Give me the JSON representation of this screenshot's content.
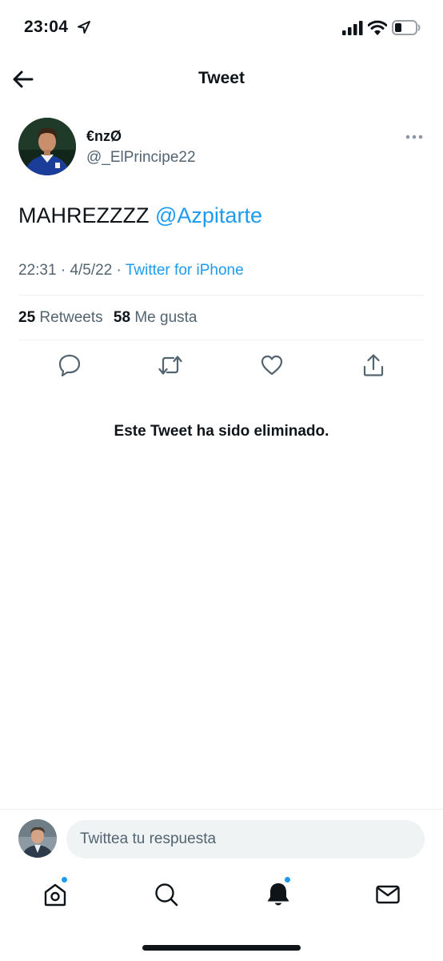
{
  "status_bar": {
    "time": "23:04",
    "icons": [
      "location-arrow-icon",
      "cellular-signal-icon",
      "wifi-icon",
      "battery-icon"
    ]
  },
  "header": {
    "title": "Tweet",
    "back_icon": "arrow-left-icon"
  },
  "tweet": {
    "author": {
      "display_name": "€nzØ",
      "handle": "@_ElPrincipe22"
    },
    "text": "MAHREZZZZ",
    "mention": "@Azpitarte",
    "time": "22:31",
    "date": "4/5/22",
    "separator": "·",
    "source": "Twitter for iPhone",
    "stats": {
      "retweets_count": "25",
      "retweets_label": "Retweets",
      "likes_count": "58",
      "likes_label": "Me gusta"
    },
    "actions": [
      "reply-icon",
      "retweet-icon",
      "like-icon",
      "share-icon"
    ]
  },
  "deleted_notice": "Este Tweet ha sido eliminado.",
  "reply": {
    "placeholder": "Twittea tu respuesta"
  },
  "tab_bar": {
    "tabs": [
      "home-icon",
      "search-icon",
      "notifications-icon",
      "messages-icon"
    ],
    "accent": "#1d9bf0"
  },
  "colors": {
    "accent": "#1d9bf0",
    "text_primary": "#0f1419",
    "text_secondary": "#536471"
  }
}
